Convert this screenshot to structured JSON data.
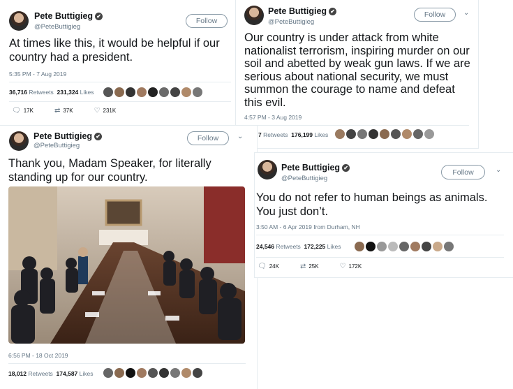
{
  "tweets": [
    {
      "name": "Pete Buttigieg",
      "handle": "@PeteButtigieg",
      "follow": "Follow",
      "text": "At times like this, it would be helpful if our country had a president.",
      "time": "5:35 PM - 7 Aug 2019",
      "retweets": "36,716",
      "retweets_label": "Retweets",
      "likes": "231,324",
      "likes_label": "Likes",
      "replies_count": "17K",
      "retweet_count": "37K",
      "like_count": "231K"
    },
    {
      "name": "Pete Buttigieg",
      "handle": "@PeteButtigieg",
      "follow": "Follow",
      "text": "Our country is under attack from white nationalist terrorism, inspiring murder on our soil and abetted by weak gun laws. If we are serious about national security, we must summon the courage to name and defeat this evil.",
      "time": "4:57 PM - 3 Aug 2019",
      "retweets": "7",
      "retweets_label": "Retweets",
      "likes": "176,199",
      "likes_label": "Likes"
    },
    {
      "name": "Pete Buttigieg",
      "handle": "@PeteButtigieg",
      "follow": "Follow",
      "text": "Thank you, Madam Speaker, for literally standing up for our country.",
      "time": "6:56 PM - 18 Oct 2019",
      "retweets": "18,012",
      "retweets_label": "Retweets",
      "likes": "174,587",
      "likes_label": "Likes"
    },
    {
      "name": "Pete Buttigieg",
      "handle": "@PeteButtigieg",
      "follow": "Follow",
      "text": "You do not refer to human beings as animals. You just don’t.",
      "time": "3:50 AM - 6 Apr 2019 from Durham, NH",
      "retweets": "24,546",
      "retweets_label": "Retweets",
      "likes": "172,225",
      "likes_label": "Likes",
      "replies_count": "24K",
      "retweet_count": "25K",
      "like_count": "172K"
    }
  ],
  "icons": {
    "verified": "✔",
    "reply": "🗨",
    "retweet": "⇄",
    "like": "♡",
    "chevron": "⌄"
  },
  "colors": {
    "text": "#14171a",
    "muted": "#657786",
    "border": "#e6ecf0"
  }
}
